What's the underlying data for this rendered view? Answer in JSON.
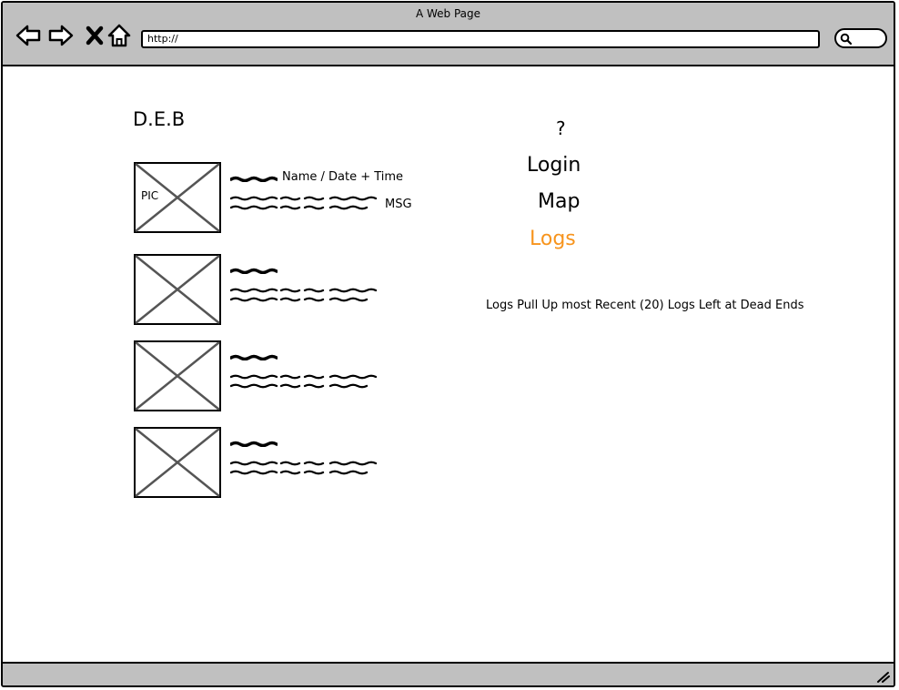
{
  "window": {
    "title": "A Web Page"
  },
  "toolbar": {
    "back_icon": "back-arrow-icon",
    "forward_icon": "forward-arrow-icon",
    "stop_icon": "close-icon",
    "home_icon": "home-icon",
    "url": "http://",
    "search_icon": "search-icon"
  },
  "page": {
    "title": "D.E.B",
    "entries": [
      {
        "pic_label": "PIC",
        "meta": "Name / Date + Time",
        "msg": "MSG"
      },
      {
        "pic_label": "",
        "meta": "",
        "msg": ""
      },
      {
        "pic_label": "",
        "meta": "",
        "msg": ""
      },
      {
        "pic_label": "",
        "meta": "",
        "msg": ""
      }
    ]
  },
  "menu": {
    "help_label": "?",
    "items": [
      {
        "label": "Login",
        "color": "#000000"
      },
      {
        "label": "Map",
        "color": "#000000"
      },
      {
        "label": "Logs",
        "color": "#f7941d",
        "active": true
      }
    ]
  },
  "notes": {
    "logs_note": "Logs Pull Up most Recent (20) Logs Left at Dead Ends"
  }
}
